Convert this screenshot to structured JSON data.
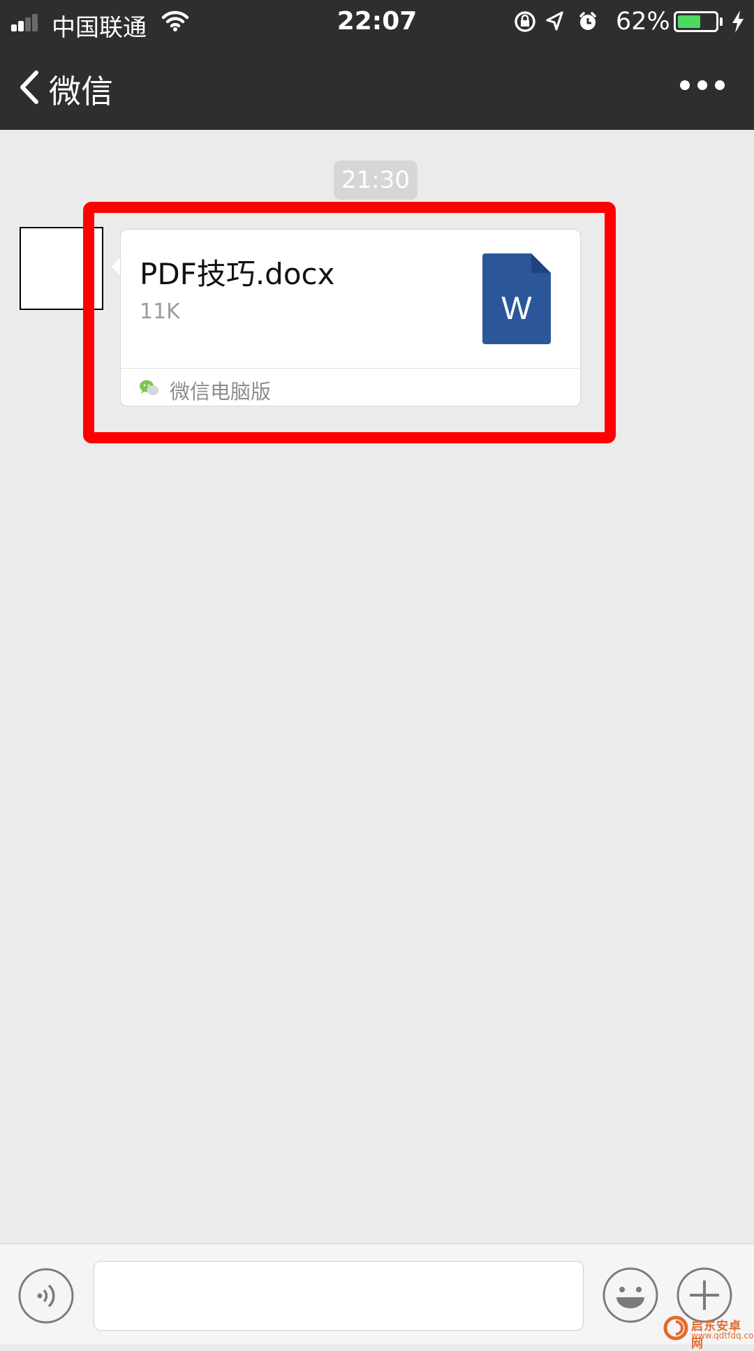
{
  "status_bar": {
    "carrier": "中国联通",
    "time": "22:07",
    "battery_percent": "62%",
    "battery_level": 0.62,
    "battery_color": "#4cd964"
  },
  "nav": {
    "back_label": "微信",
    "back_icon": "chevron-left-icon",
    "more_icon": "more-dots-icon"
  },
  "chat": {
    "timestamp": "21:30",
    "message": {
      "file_name": "PDF技巧.docx",
      "file_size": "11K",
      "file_icon": "word-document-icon",
      "file_icon_letter": "W",
      "file_icon_color": "#2b579a",
      "source": "微信电脑版"
    },
    "highlight_color": "#ff0000"
  },
  "input_bar": {
    "voice_icon": "voice-icon",
    "emoji_icon": "emoji-icon",
    "plus_icon": "plus-icon",
    "input_value": ""
  },
  "watermark": {
    "brand": "启东安卓网",
    "url": "www.qdtfdq.com"
  }
}
